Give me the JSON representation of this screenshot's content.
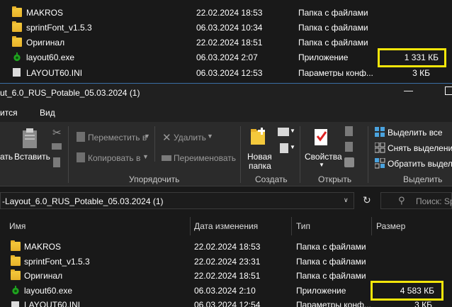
{
  "back_window": {
    "rows": [
      {
        "name": "MAKROS",
        "date": "22.02.2024 18:53",
        "type": "Папка с файлами",
        "size": "",
        "icon": "folder-icon"
      },
      {
        "name": "sprintFont_v1.5.3",
        "date": "06.03.2024 10:34",
        "type": "Папка с файлами",
        "size": "",
        "icon": "folder-icon"
      },
      {
        "name": "Оригинал",
        "date": "22.02.2024 18:51",
        "type": "Папка с файлами",
        "size": "",
        "icon": "folder-icon"
      },
      {
        "name": "layout60.exe",
        "date": "06.03.2024 2:07",
        "type": "Приложение",
        "size": "1 331 КБ",
        "icon": "exe-icon"
      },
      {
        "name": "LAYOUT60.INI",
        "date": "06.03.2024 12:53",
        "type": "Параметры конф...",
        "size": "3 КБ",
        "icon": "ini-icon"
      }
    ]
  },
  "front_window": {
    "title": "ut_6.0_RUS_Potable_05.03.2024 (1)",
    "menu": [
      "ится",
      "Вид"
    ],
    "ribbon": {
      "paste_partial": "ать",
      "paste": "Вставить",
      "move_to": "Переместить в",
      "copy_to": "Копировать в",
      "delete": "Удалить",
      "rename": "Переименовать",
      "new_folder_line1": "Новая",
      "new_folder_line2": "папка",
      "properties": "Свойства",
      "select_all": "Выделить все",
      "select_none": "Снять выделение",
      "invert_selection": "Обратить выделени",
      "groups": {
        "organize": "Упорядочить",
        "create": "Создать",
        "open": "Открыть",
        "select": "Выделить"
      }
    },
    "address": "-Layout_6.0_RUS_Potable_05.03.2024 (1)",
    "search_placeholder": "Поиск: Sp",
    "columns": {
      "name": "Имя",
      "date": "Дата изменения",
      "type": "Тип",
      "size": "Размер"
    },
    "rows": [
      {
        "name": "MAKROS",
        "date": "22.02.2024 18:53",
        "type": "Папка с файлами",
        "size": "",
        "icon": "folder-icon"
      },
      {
        "name": "sprintFont_v1.5.3",
        "date": "22.02.2024 23:31",
        "type": "Папка с файлами",
        "size": "",
        "icon": "folder-icon"
      },
      {
        "name": "Оригинал",
        "date": "22.02.2024 18:51",
        "type": "Папка с файлами",
        "size": "",
        "icon": "folder-icon"
      },
      {
        "name": "layout60.exe",
        "date": "06.03.2024 2:10",
        "type": "Приложение",
        "size": "4 583 КБ",
        "icon": "exe-icon"
      },
      {
        "name": "LAYOUT60.INI",
        "date": "06.03.2024 12:54",
        "type": "Параметры конф...",
        "size": "3 КБ",
        "icon": "ini-icon"
      }
    ]
  },
  "colors": {
    "highlight": "#f5e60a",
    "folder": "#f4c93c",
    "accent": "#3a6ea5"
  }
}
